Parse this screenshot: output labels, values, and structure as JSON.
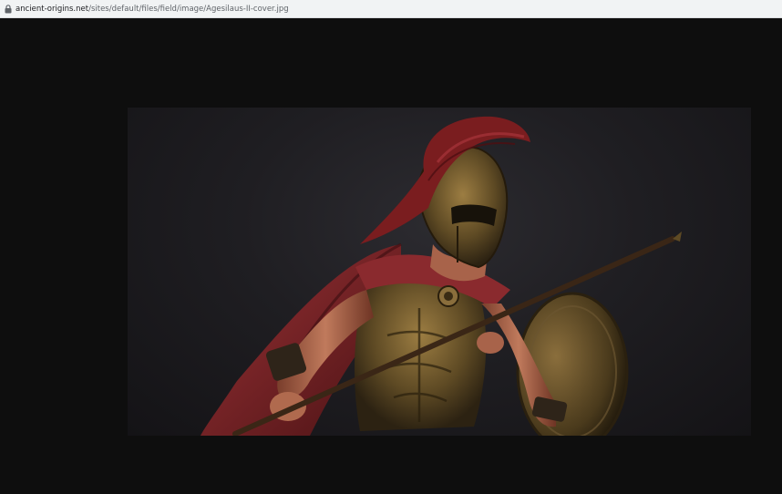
{
  "browser": {
    "address_bar": {
      "url_domain": "ancient-origins.net",
      "url_path": "/sites/default/files/field/image/Agesilaus-II-cover.jpg",
      "secure_icon": "lock-icon"
    }
  },
  "viewer": {
    "background_color": "#0e0e0e",
    "image_subject": "spartan-warrior-statue"
  },
  "colors": {
    "address_bar_bg": "#f1f3f4",
    "url_text": "#5f6368",
    "crest_red": "#7a1d1f",
    "cape_red": "#8a2a2e",
    "bronze": "#7a6232",
    "skin": "#b06a4e"
  }
}
